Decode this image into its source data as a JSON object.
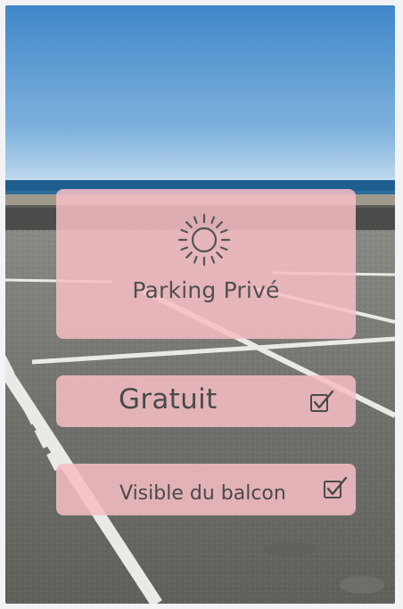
{
  "main_card": {
    "icon": "sun-icon",
    "title": "Parking Privé"
  },
  "options": [
    {
      "label": "Gratuit",
      "checked": true,
      "icon": "checkbox-checked-icon"
    },
    {
      "label": "Visible du balcon",
      "checked": true,
      "icon": "checkbox-checked-icon"
    }
  ],
  "colors": {
    "card_overlay": "#f6bec4",
    "text": "#4d4d4d",
    "sky_top": "#3f87c9",
    "sky_bottom": "#b7d4ea",
    "sea": "#1f5f8f",
    "asphalt": "#6f6f6b"
  }
}
